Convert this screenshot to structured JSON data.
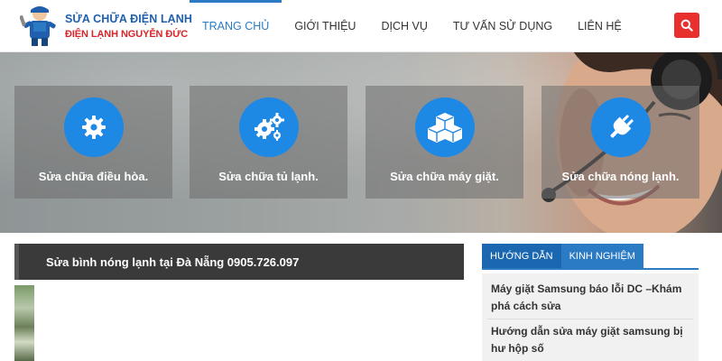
{
  "logo": {
    "line1": "SỬA CHỮA ĐIỆN LẠNH",
    "line2": "ĐIỆN LẠNH NGUYỄN ĐỨC"
  },
  "nav": {
    "items": [
      {
        "label": "TRANG CHỦ",
        "active": true
      },
      {
        "label": "GIỚI THIỆU",
        "active": false
      },
      {
        "label": "DỊCH VỤ",
        "active": false
      },
      {
        "label": "TƯ VẤN SỬ DỤNG",
        "active": false
      },
      {
        "label": "LIÊN HỆ",
        "active": false
      }
    ],
    "search_icon": "search-icon"
  },
  "services": [
    {
      "label": "Sửa chữa điều hòa.",
      "icon": "gear-icon"
    },
    {
      "label": "Sửa chữa tủ lạnh.",
      "icon": "gears-icon"
    },
    {
      "label": "Sửa chữa máy giặt.",
      "icon": "cubes-icon"
    },
    {
      "label": "Sửa chữa nóng lạnh.",
      "icon": "plug-icon"
    }
  ],
  "post": {
    "title": "Sửa bình nóng lạnh tại Đà Nẵng 0905.726.097"
  },
  "sidebar": {
    "tabs": [
      {
        "label": "HƯỚNG DẪN",
        "active": true
      },
      {
        "label": "KINH NGHIỆM",
        "active": false
      }
    ],
    "items": [
      {
        "title": "Máy giặt Samsung báo lỗi DC –Khám phá cách sửa"
      },
      {
        "title": "Hướng dẫn sửa máy giặt samsung bị hư hộp số"
      }
    ]
  },
  "colors": {
    "accent": "#2b7bc4",
    "service_circle": "#1e88e5",
    "search_button": "#e8312f",
    "post_bar": "#3a3a3a"
  }
}
